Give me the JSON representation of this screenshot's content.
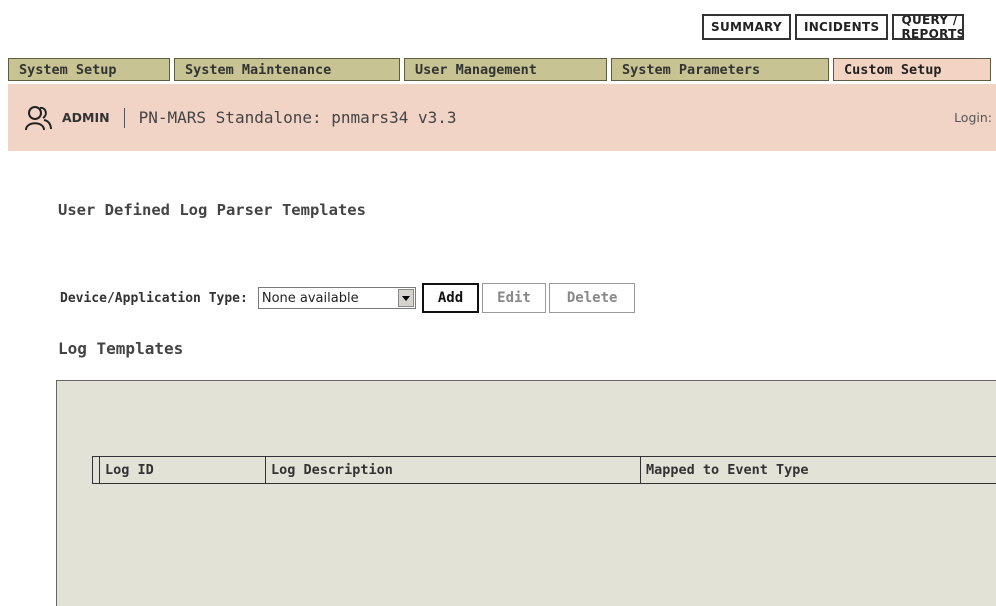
{
  "top_tabs": [
    "SUMMARY",
    "INCIDENTS",
    "QUERY / REPORTS"
  ],
  "nav_tabs": [
    {
      "label": "System Setup",
      "active": false
    },
    {
      "label": "System Maintenance",
      "active": false
    },
    {
      "label": "User Management",
      "active": false
    },
    {
      "label": "System Parameters",
      "active": false
    },
    {
      "label": "Custom Setup",
      "active": true
    }
  ],
  "header": {
    "role": "ADMIN",
    "title": "PN-MARS Standalone: pnmars34 v3.3",
    "login_label": "Login:"
  },
  "page": {
    "title": "User Defined Log Parser Templates",
    "device_label": "Device/Application Type:",
    "device_select": "None available",
    "buttons": {
      "add": "Add",
      "edit": "Edit",
      "delete": "Delete"
    },
    "section_title": "Log Templates",
    "columns": [
      "Log ID",
      "Log Description",
      "Mapped to Event Type"
    ]
  },
  "colors": {
    "nav_tab_bg": "#c7c392",
    "active_tab_bg": "#f3d3c2",
    "header_bg": "#f1d4c6",
    "panel_bg": "#e3e2d7"
  }
}
